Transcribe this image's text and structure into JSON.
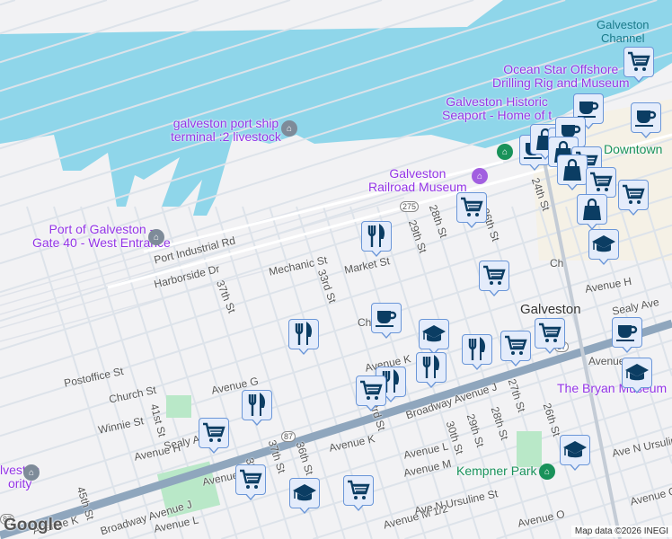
{
  "map": {
    "water_labels": [
      "Galveston\nChannel"
    ],
    "poi_labels": [
      "Ocean Star Offshore\nDrilling Rig and Museum",
      "Galveston Historic\nSeaport - Home of t",
      "galveston port ship\nterminal :2 livestock",
      "Galveston\nRailroad Museum",
      "Port of Galveston -\nGate 40 - West Entrance",
      "The Bryan Museum",
      "lveston\nority"
    ],
    "park_labels": [
      "Kempner Park",
      "Downtown"
    ],
    "city_label": "Galveston",
    "street_labels": [
      "Port Industrial Rd",
      "Harborside Dr",
      "Mechanic St",
      "Market St",
      "33rd St",
      "37th St",
      "29th St",
      "28th St",
      "26th St",
      "24th St",
      "Avenue H",
      "Sealy Ave",
      "Postoffice St",
      "Church St",
      "Avenue G",
      "Winnie St",
      "41st St",
      "Sealy Ave",
      "Avenue H",
      "Broadway Avenue J",
      "Broadway Avenue J",
      "Avenue K",
      "Avenue K",
      "36th St",
      "37th St",
      "38th St",
      "45th St",
      "Avenue L",
      "Avenue L",
      "Avenue M",
      "Avenue M 1/2",
      "33rd St",
      "30th St",
      "29th St",
      "28th St",
      "27th St",
      "26th St",
      "Ave N Ursuline St",
      "Ave N Ursuline",
      "Avenue O",
      "Avenue K",
      "Avenue K",
      "Avenue O",
      "Chu",
      "Ch",
      "Avenue"
    ],
    "route_shields": [
      "275",
      "87",
      "87",
      "87"
    ],
    "markers": [
      "cart",
      "cup",
      "cup",
      "cup",
      "bag",
      "bag",
      "cup",
      "bag",
      "cart",
      "bag",
      "cart",
      "cart",
      "cart",
      "bag",
      "grad",
      "fork",
      "cart",
      "cup",
      "grad",
      "fork",
      "fork",
      "cart",
      "cart",
      "cup",
      "grad",
      "fork",
      "fork",
      "cart",
      "fork",
      "cart",
      "cart",
      "grad",
      "cart",
      "grad"
    ]
  },
  "footer": {
    "logo": "Google",
    "attribution": "Map data ©2026 INEGI"
  },
  "colors": {
    "water": "#8fd6ea",
    "land": "#f2f2f4",
    "road": "#ffffff",
    "highway": "#8fa6bd",
    "marker_bg": "#e4ecfb",
    "icon": "#0b3d63"
  }
}
